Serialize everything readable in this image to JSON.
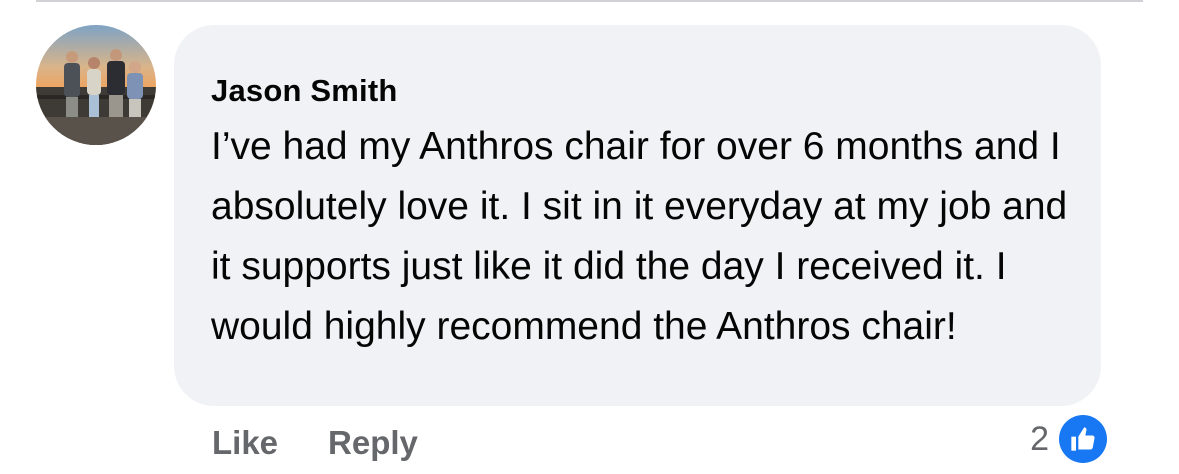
{
  "comment": {
    "author": "Jason Smith",
    "text": "I’ve had my Anthros chair for over 6 months and I absolutely love it. I sit in it everyday at my job and it supports just like it did the day I received it. I would highly recommend the Anthros chair!",
    "avatar_icon": "profile-photo",
    "bubble_color": "#f0f2f5"
  },
  "actions": {
    "like_label": "Like",
    "reply_label": "Reply"
  },
  "reactions": {
    "count": "2",
    "icon": "thumbs-up-icon",
    "color": "#1877f2"
  }
}
